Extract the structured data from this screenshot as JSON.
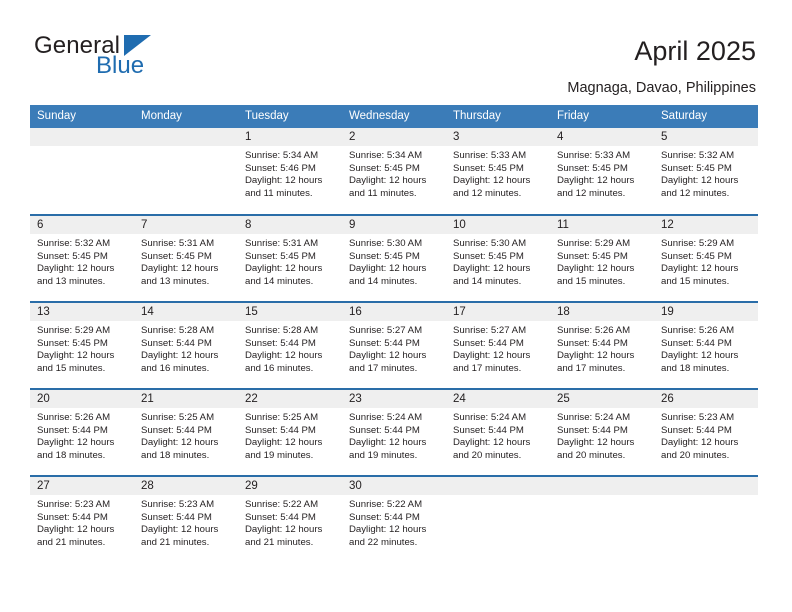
{
  "brand": {
    "name_part1": "General",
    "name_part2": "Blue",
    "triangle_color": "#1f6cb0",
    "icon": "triangle-icon"
  },
  "header": {
    "title": "April 2025",
    "subtitle": "Magnaga, Davao, Philippines"
  },
  "theme": {
    "header_bg": "#3b7cb8",
    "row_border": "#2a6da8",
    "daynum_bg": "#efefef",
    "text": "#231f20"
  },
  "calendar": {
    "weekday_headers": [
      "Sunday",
      "Monday",
      "Tuesday",
      "Wednesday",
      "Thursday",
      "Friday",
      "Saturday"
    ],
    "weeks": [
      [
        {
          "day": "",
          "sunrise": "",
          "sunset": "",
          "daylight": ""
        },
        {
          "day": "",
          "sunrise": "",
          "sunset": "",
          "daylight": ""
        },
        {
          "day": "1",
          "sunrise": "Sunrise: 5:34 AM",
          "sunset": "Sunset: 5:46 PM",
          "daylight": "Daylight: 12 hours and 11 minutes."
        },
        {
          "day": "2",
          "sunrise": "Sunrise: 5:34 AM",
          "sunset": "Sunset: 5:45 PM",
          "daylight": "Daylight: 12 hours and 11 minutes."
        },
        {
          "day": "3",
          "sunrise": "Sunrise: 5:33 AM",
          "sunset": "Sunset: 5:45 PM",
          "daylight": "Daylight: 12 hours and 12 minutes."
        },
        {
          "day": "4",
          "sunrise": "Sunrise: 5:33 AM",
          "sunset": "Sunset: 5:45 PM",
          "daylight": "Daylight: 12 hours and 12 minutes."
        },
        {
          "day": "5",
          "sunrise": "Sunrise: 5:32 AM",
          "sunset": "Sunset: 5:45 PM",
          "daylight": "Daylight: 12 hours and 12 minutes."
        }
      ],
      [
        {
          "day": "6",
          "sunrise": "Sunrise: 5:32 AM",
          "sunset": "Sunset: 5:45 PM",
          "daylight": "Daylight: 12 hours and 13 minutes."
        },
        {
          "day": "7",
          "sunrise": "Sunrise: 5:31 AM",
          "sunset": "Sunset: 5:45 PM",
          "daylight": "Daylight: 12 hours and 13 minutes."
        },
        {
          "day": "8",
          "sunrise": "Sunrise: 5:31 AM",
          "sunset": "Sunset: 5:45 PM",
          "daylight": "Daylight: 12 hours and 14 minutes."
        },
        {
          "day": "9",
          "sunrise": "Sunrise: 5:30 AM",
          "sunset": "Sunset: 5:45 PM",
          "daylight": "Daylight: 12 hours and 14 minutes."
        },
        {
          "day": "10",
          "sunrise": "Sunrise: 5:30 AM",
          "sunset": "Sunset: 5:45 PM",
          "daylight": "Daylight: 12 hours and 14 minutes."
        },
        {
          "day": "11",
          "sunrise": "Sunrise: 5:29 AM",
          "sunset": "Sunset: 5:45 PM",
          "daylight": "Daylight: 12 hours and 15 minutes."
        },
        {
          "day": "12",
          "sunrise": "Sunrise: 5:29 AM",
          "sunset": "Sunset: 5:45 PM",
          "daylight": "Daylight: 12 hours and 15 minutes."
        }
      ],
      [
        {
          "day": "13",
          "sunrise": "Sunrise: 5:29 AM",
          "sunset": "Sunset: 5:45 PM",
          "daylight": "Daylight: 12 hours and 15 minutes."
        },
        {
          "day": "14",
          "sunrise": "Sunrise: 5:28 AM",
          "sunset": "Sunset: 5:44 PM",
          "daylight": "Daylight: 12 hours and 16 minutes."
        },
        {
          "day": "15",
          "sunrise": "Sunrise: 5:28 AM",
          "sunset": "Sunset: 5:44 PM",
          "daylight": "Daylight: 12 hours and 16 minutes."
        },
        {
          "day": "16",
          "sunrise": "Sunrise: 5:27 AM",
          "sunset": "Sunset: 5:44 PM",
          "daylight": "Daylight: 12 hours and 17 minutes."
        },
        {
          "day": "17",
          "sunrise": "Sunrise: 5:27 AM",
          "sunset": "Sunset: 5:44 PM",
          "daylight": "Daylight: 12 hours and 17 minutes."
        },
        {
          "day": "18",
          "sunrise": "Sunrise: 5:26 AM",
          "sunset": "Sunset: 5:44 PM",
          "daylight": "Daylight: 12 hours and 17 minutes."
        },
        {
          "day": "19",
          "sunrise": "Sunrise: 5:26 AM",
          "sunset": "Sunset: 5:44 PM",
          "daylight": "Daylight: 12 hours and 18 minutes."
        }
      ],
      [
        {
          "day": "20",
          "sunrise": "Sunrise: 5:26 AM",
          "sunset": "Sunset: 5:44 PM",
          "daylight": "Daylight: 12 hours and 18 minutes."
        },
        {
          "day": "21",
          "sunrise": "Sunrise: 5:25 AM",
          "sunset": "Sunset: 5:44 PM",
          "daylight": "Daylight: 12 hours and 18 minutes."
        },
        {
          "day": "22",
          "sunrise": "Sunrise: 5:25 AM",
          "sunset": "Sunset: 5:44 PM",
          "daylight": "Daylight: 12 hours and 19 minutes."
        },
        {
          "day": "23",
          "sunrise": "Sunrise: 5:24 AM",
          "sunset": "Sunset: 5:44 PM",
          "daylight": "Daylight: 12 hours and 19 minutes."
        },
        {
          "day": "24",
          "sunrise": "Sunrise: 5:24 AM",
          "sunset": "Sunset: 5:44 PM",
          "daylight": "Daylight: 12 hours and 20 minutes."
        },
        {
          "day": "25",
          "sunrise": "Sunrise: 5:24 AM",
          "sunset": "Sunset: 5:44 PM",
          "daylight": "Daylight: 12 hours and 20 minutes."
        },
        {
          "day": "26",
          "sunrise": "Sunrise: 5:23 AM",
          "sunset": "Sunset: 5:44 PM",
          "daylight": "Daylight: 12 hours and 20 minutes."
        }
      ],
      [
        {
          "day": "27",
          "sunrise": "Sunrise: 5:23 AM",
          "sunset": "Sunset: 5:44 PM",
          "daylight": "Daylight: 12 hours and 21 minutes."
        },
        {
          "day": "28",
          "sunrise": "Sunrise: 5:23 AM",
          "sunset": "Sunset: 5:44 PM",
          "daylight": "Daylight: 12 hours and 21 minutes."
        },
        {
          "day": "29",
          "sunrise": "Sunrise: 5:22 AM",
          "sunset": "Sunset: 5:44 PM",
          "daylight": "Daylight: 12 hours and 21 minutes."
        },
        {
          "day": "30",
          "sunrise": "Sunrise: 5:22 AM",
          "sunset": "Sunset: 5:44 PM",
          "daylight": "Daylight: 12 hours and 22 minutes."
        },
        {
          "day": "",
          "sunrise": "",
          "sunset": "",
          "daylight": ""
        },
        {
          "day": "",
          "sunrise": "",
          "sunset": "",
          "daylight": ""
        },
        {
          "day": "",
          "sunrise": "",
          "sunset": "",
          "daylight": ""
        }
      ]
    ]
  }
}
